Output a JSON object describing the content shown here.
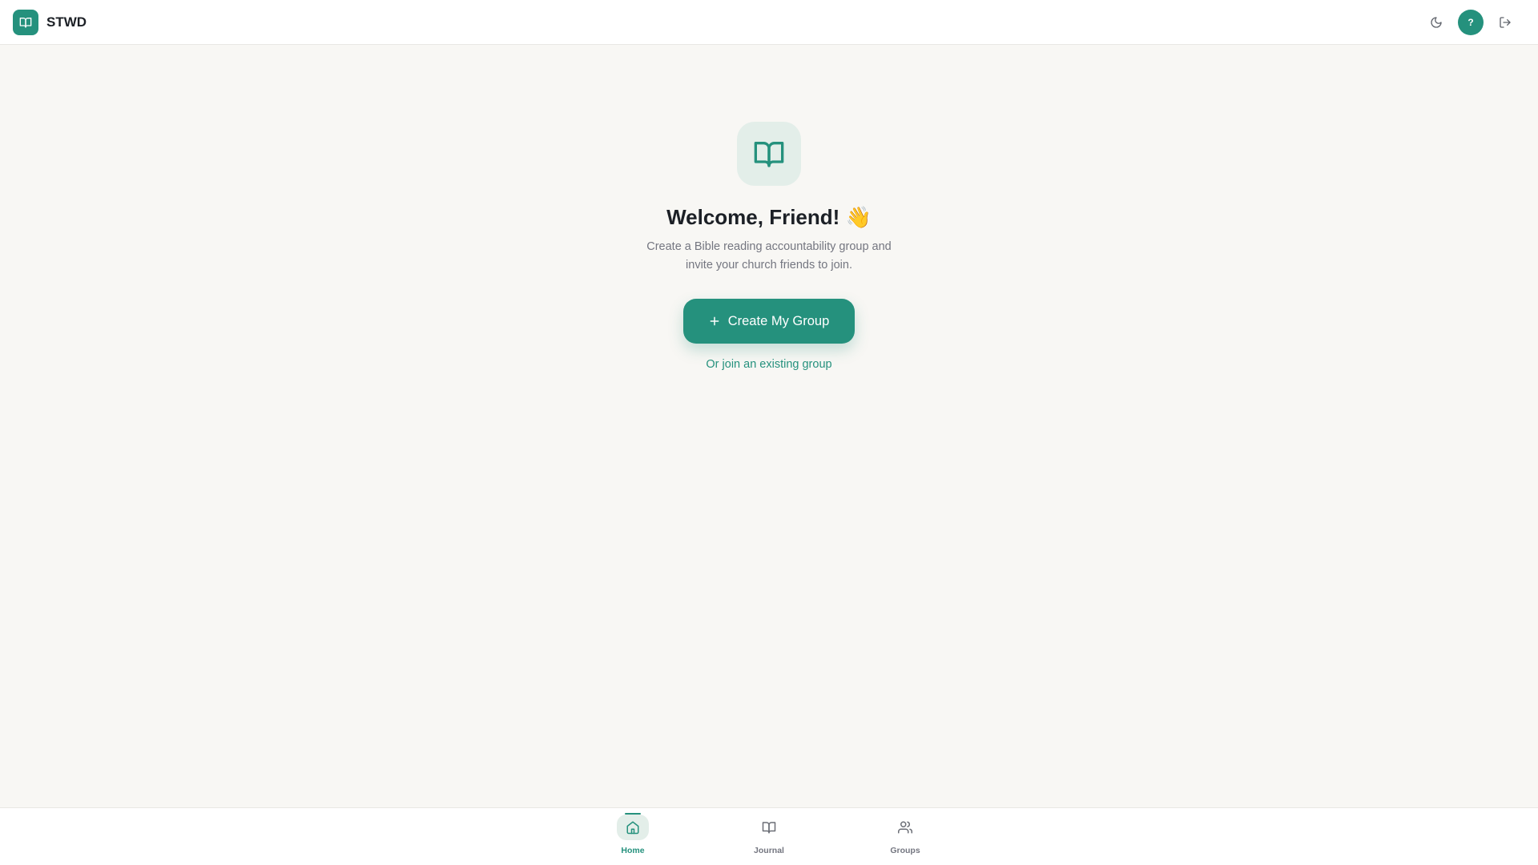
{
  "app": {
    "name": "STWD",
    "logo_icon": "book-open-icon",
    "accent_color": "#25917d"
  },
  "header": {
    "theme_toggle_icon": "moon-icon",
    "avatar_initial": "?",
    "logout_icon": "log-out-icon"
  },
  "main": {
    "hero_icon": "book-open-icon",
    "welcome_title": "Welcome, Friend! 👋",
    "subtitle": "Create a Bible reading accountability group and invite your church friends to join.",
    "create_button_label": "Create My Group",
    "create_button_icon": "plus-icon",
    "join_link_label": "Or join an existing group"
  },
  "bottom_nav": {
    "items": [
      {
        "label": "Home",
        "icon": "home-icon",
        "active": true
      },
      {
        "label": "Journal",
        "icon": "book-open-icon",
        "active": false
      },
      {
        "label": "Groups",
        "icon": "users-icon",
        "active": false
      }
    ]
  }
}
